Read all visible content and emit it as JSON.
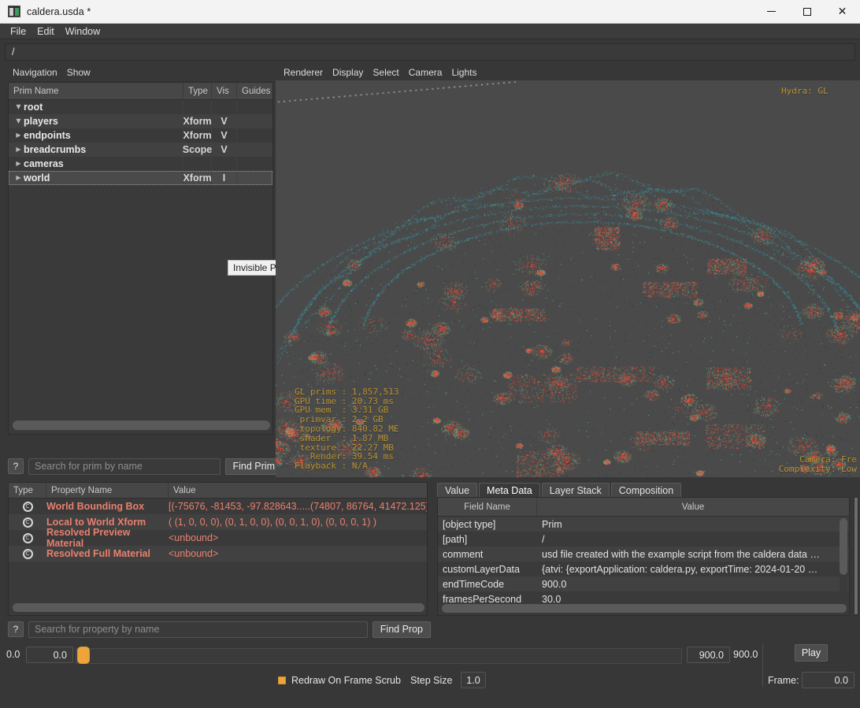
{
  "window": {
    "title": "caldera.usda *",
    "icon": "usd-file-icon",
    "minimize": "–",
    "maximize": "□",
    "close": "✕"
  },
  "menubar": {
    "items": [
      "File",
      "Edit",
      "Window"
    ]
  },
  "pathbar": {
    "value": "/"
  },
  "navigation": {
    "menus": [
      "Navigation",
      "Show"
    ],
    "columns": [
      "Prim Name",
      "Type",
      "Vis",
      "Guides"
    ],
    "rows": [
      {
        "name": "root",
        "type": "",
        "vis": "",
        "guides": "",
        "indent": 0,
        "arrow": "down",
        "selected": false
      },
      {
        "name": "players",
        "type": "Xform",
        "vis": "V",
        "guides": "",
        "indent": 1,
        "arrow": "down",
        "selected": false
      },
      {
        "name": "endpoints",
        "type": "Xform",
        "vis": "V",
        "guides": "",
        "indent": 2,
        "arrow": "right",
        "selected": false
      },
      {
        "name": "breadcrumbs",
        "type": "Scope",
        "vis": "V",
        "guides": "",
        "indent": 2,
        "arrow": "right",
        "selected": false
      },
      {
        "name": "cameras",
        "type": "",
        "vis": "",
        "guides": "",
        "indent": 1,
        "arrow": "right",
        "selected": false
      },
      {
        "name": "world",
        "type": "Xform",
        "vis": "I",
        "guides": "",
        "indent": 1,
        "arrow": "right",
        "selected": true
      }
    ],
    "tooltip": "Invisible Prim",
    "search": {
      "help": "?",
      "placeholder": "Search for prim by name",
      "value": "",
      "button": "Find Prim"
    }
  },
  "viewport": {
    "menus": [
      "Renderer",
      "Display",
      "Select",
      "Camera",
      "Lights"
    ],
    "hud_top_right": "Hydra: GL",
    "hud_stats": [
      {
        "label": "GL prims ",
        "value": "1,857,513"
      },
      {
        "label": "GPU time ",
        "value": "20.73 ms"
      },
      {
        "label": "GPU mem  ",
        "value": "3.31 GB"
      },
      {
        "label": " primvar ",
        "value": "2.2 GB"
      },
      {
        "label": " topology",
        "value": "840.82 ME"
      },
      {
        "label": " shader  ",
        "value": "1.87 MB"
      },
      {
        "label": " texture ",
        "value": "22.27 MB"
      },
      {
        "label": "   Render",
        "value": "39.54 ms"
      },
      {
        "label": "Playback ",
        "value": "N/A"
      }
    ],
    "hud_bottom_right": [
      "Camera: Fre",
      "Complexity: Low"
    ],
    "colors": {
      "background": "#4a4a4a",
      "point_cloud_dark": "#2e3a44",
      "point_hot": "#ef4b36",
      "point_mid": "#4fb88f",
      "point_cool": "#2f88a8",
      "hud_text": "#b8922f"
    }
  },
  "properties": {
    "columns": [
      "Type",
      "Property Name",
      "Value"
    ],
    "rows": [
      {
        "icon": "C",
        "name": "World Bounding Box",
        "value": "[(-75676, -81453, -97.828643.....(74807, 86764, 41472.125)]"
      },
      {
        "icon": "C",
        "name": "Local to World Xform",
        "value": "( (1, 0, 0, 0), (0, 1, 0, 0), (0, 0, 1, 0), (0, 0, 0, 1) )"
      },
      {
        "icon": "C",
        "name": "Resolved Preview Material",
        "value": "<unbound>"
      },
      {
        "icon": "C",
        "name": "Resolved Full Material",
        "value": "<unbound>"
      }
    ],
    "search": {
      "help": "?",
      "placeholder": "Search for property by name",
      "value": "",
      "button": "Find Prop"
    }
  },
  "metadata": {
    "tabs": [
      {
        "label": "Value",
        "active": false
      },
      {
        "label": "Meta Data",
        "active": true
      },
      {
        "label": "Layer Stack",
        "active": false
      },
      {
        "label": "Composition",
        "active": false
      }
    ],
    "columns": [
      "Field Name",
      "Value"
    ],
    "rows": [
      {
        "field": "[object type]",
        "value": "Prim"
      },
      {
        "field": "[path]",
        "value": "/"
      },
      {
        "field": "comment",
        "value": "usd file created with the example script from the caldera data …"
      },
      {
        "field": "customLayerData",
        "value": "{atvi: {exportApplication: caldera.py, exportTime: 2024-01-20 …"
      },
      {
        "field": "endTimeCode",
        "value": "900.0"
      },
      {
        "field": "framesPerSecond",
        "value": "30.0"
      }
    ]
  },
  "timeline": {
    "start_label": "0.0",
    "start_field": "0.0",
    "end_field": "900.0",
    "end_label": "900.0",
    "play_button": "Play",
    "frame_label": "Frame:",
    "frame_value": "0.0",
    "redraw_checkbox_label": "Redraw On Frame Scrub",
    "redraw_checked": true,
    "step_size_label": "Step Size",
    "step_size_value": "1.0"
  }
}
